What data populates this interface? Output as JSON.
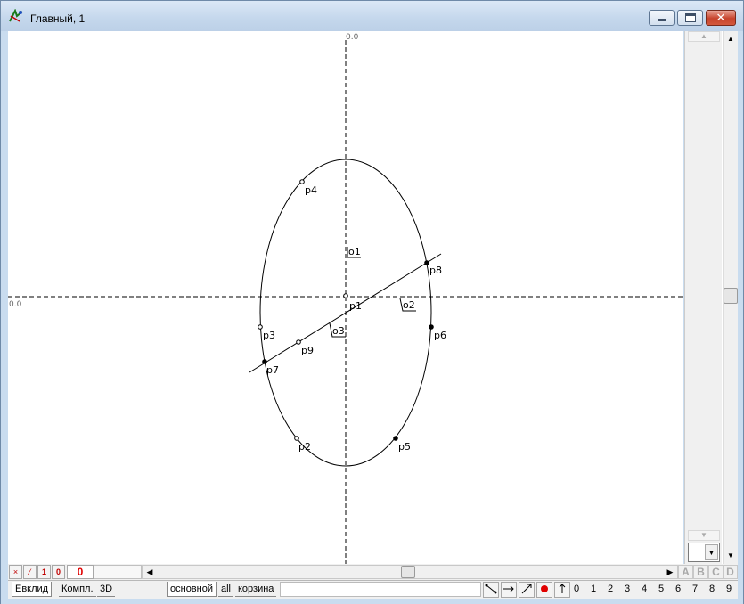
{
  "window": {
    "title": "Главный, 1"
  },
  "canvas": {
    "axis_label_top": "0.0",
    "axis_label_left": "0.0",
    "points": {
      "p1": "p1",
      "p2": "p2",
      "p3": "p3",
      "p4": "p4",
      "p5": "p5",
      "p6": "p6",
      "p7": "p7",
      "p8": "p8",
      "p9": "p9"
    },
    "angles": {
      "o1": "o1",
      "o2": "o2",
      "o3": "o3"
    }
  },
  "bottom": {
    "counter": "0",
    "mini_x": "×",
    "mini_slash": "⁄",
    "mini_one": "1",
    "mini_zero": "0",
    "letters": [
      "A",
      "B",
      "C",
      "D"
    ]
  },
  "tabs": {
    "left": [
      "Евклид",
      "Компл.",
      "3D"
    ],
    "right": [
      "основной",
      "all",
      "корзина"
    ]
  },
  "digits": [
    "0",
    "1",
    "2",
    "3",
    "4",
    "5",
    "6",
    "7",
    "8",
    "9"
  ]
}
